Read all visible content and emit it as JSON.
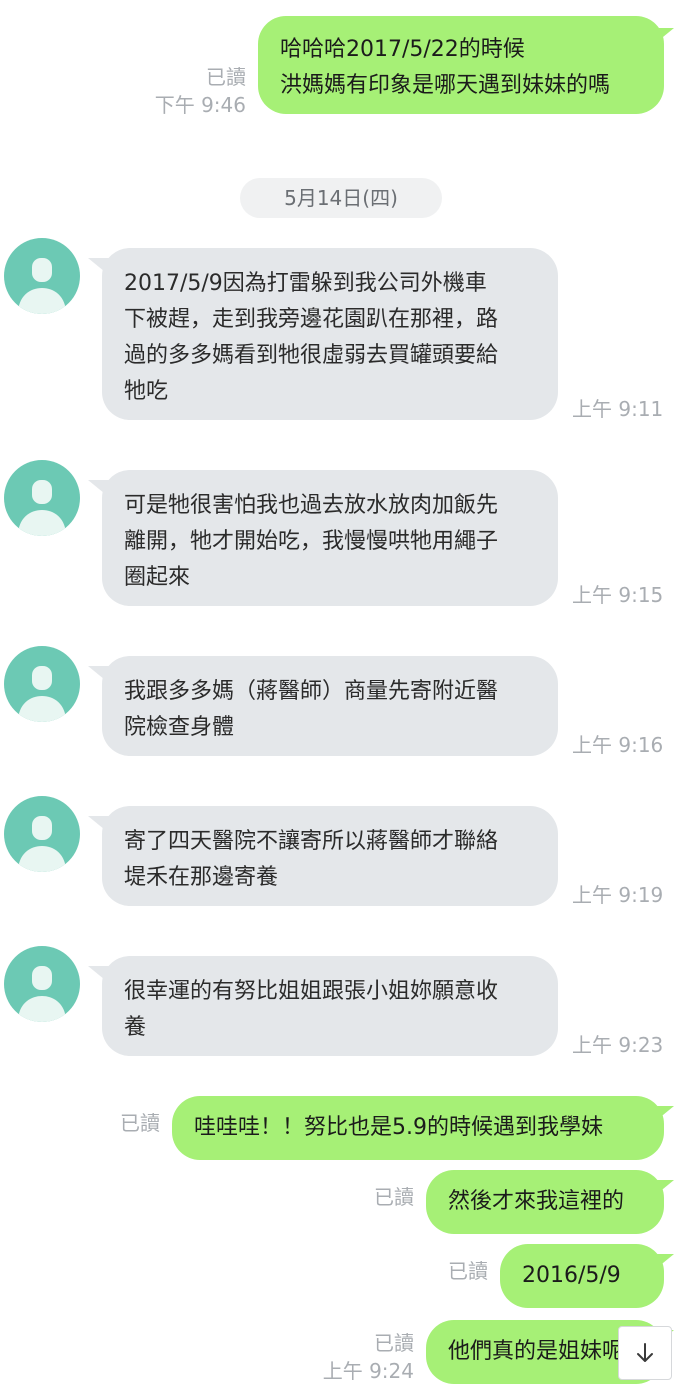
{
  "messages": {
    "m1": {
      "lines": "哈哈哈2017/5/22的時候\n洪媽媽有印象是哪天遇到妹妹的嗎",
      "read": "已讀",
      "time": "下午 9:46"
    },
    "date_divider": "5月14日(四)",
    "m2": {
      "lines": "2017/5/9因為打雷躲到我公司外機車\n下被趕，走到我旁邊花園趴在那裡，路\n過的多多媽看到牠很虛弱去買罐頭要給\n牠吃",
      "time": "上午 9:11"
    },
    "m3": {
      "lines": "可是牠很害怕我也過去放水放肉加飯先\n離開，牠才開始吃，我慢慢哄牠用繩子\n圈起來",
      "time": "上午 9:15"
    },
    "m4": {
      "lines": "我跟多多媽（蔣醫師）商量先寄附近醫\n院檢查身體",
      "time": "上午 9:16"
    },
    "m5": {
      "lines": "寄了四天醫院不讓寄所以蔣醫師才聯絡\n堤禾在那邊寄養",
      "time": "上午 9:19"
    },
    "m6": {
      "lines": "很幸運的有努比姐姐跟張小姐妳願意收\n養",
      "time": "上午 9:23"
    },
    "m7": {
      "lines": "哇哇哇！！努比也是5.9的時候遇到我學妹",
      "read": "已讀"
    },
    "m8": {
      "lines": "然後才來我這裡的",
      "read": "已讀"
    },
    "m9": {
      "lines": "2016/5/9",
      "read": "已讀"
    },
    "m10": {
      "lines": "他們真的是姐妹呢",
      "read": "已讀",
      "time": "上午 9:24"
    }
  },
  "icons": {
    "avatar": "default-person-avatar",
    "scroll": "arrow-down-icon"
  },
  "colors": {
    "outgoing": "#a6f076",
    "incoming": "#e4e7ea",
    "avatar": "#6cc9b4"
  }
}
